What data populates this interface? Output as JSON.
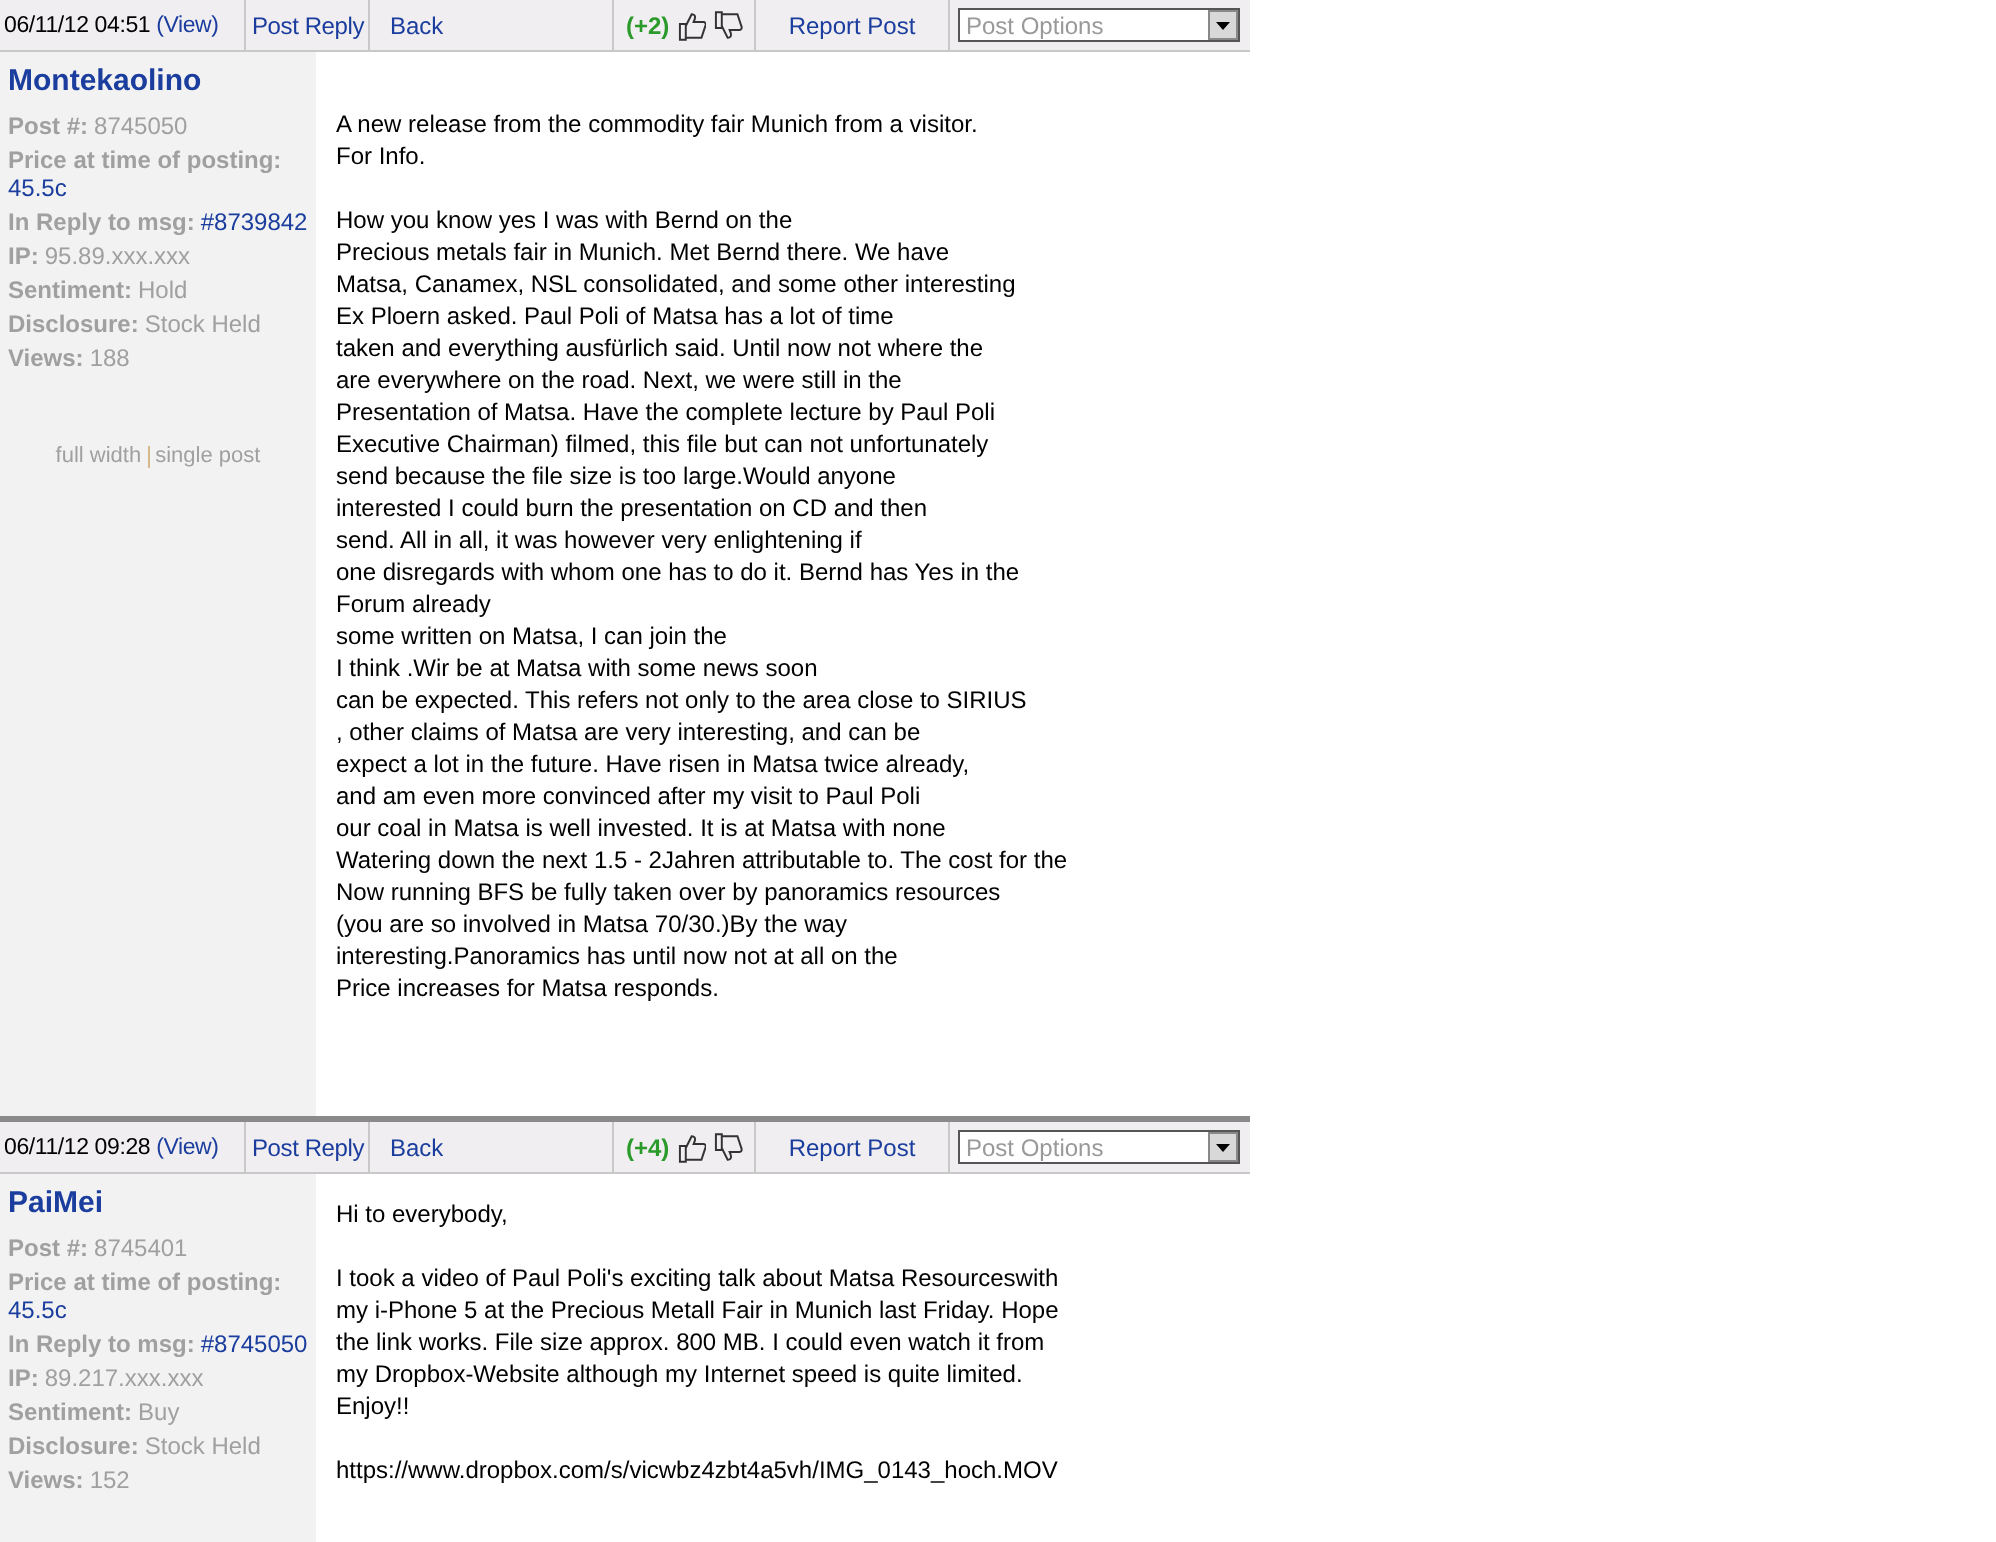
{
  "posts": [
    {
      "header": {
        "date": "06/11/12 04:51",
        "view": "(View)",
        "reply": "Post Reply",
        "back": "Back",
        "votes": "(+2)",
        "report": "Report Post",
        "options": {
          "placeholder": "Post Options"
        }
      },
      "author": "Montekaolino",
      "fields": [
        {
          "label": "Post #:",
          "value": "8745050",
          "link": false
        },
        {
          "label": "Price at time of posting:",
          "value": "45.5c",
          "link": true
        },
        {
          "label": "In Reply to msg:",
          "value": "#8739842",
          "link": true
        },
        {
          "label": "IP:",
          "value": "95.89.xxx.xxx",
          "link": false
        },
        {
          "label": "Sentiment:",
          "value": "Hold",
          "link": false
        },
        {
          "label": "Disclosure:",
          "value": "Stock Held",
          "link": false
        },
        {
          "label": "Views:",
          "value": "188",
          "link": false
        }
      ],
      "links": [
        "full width",
        "single post"
      ],
      "paragraphs": [
        "A new release from the commodity fair Munich from a visitor.\nFor Info.",
        "How you know yes I was with Bernd on the\nPrecious metals fair in Munich. Met Bernd there. We have\nMatsa, Canamex, NSL consolidated, and some other interesting\nEx Ploern asked. Paul Poli of Matsa has a lot of time\ntaken and everything ausfürlich said. Until now not where the\nare everywhere on the road. Next, we were still in the\nPresentation of Matsa. Have the complete lecture by Paul Poli\nExecutive Chairman) filmed, this file but can not unfortunately\nsend because the file size is too large.Would anyone\ninterested I could burn the presentation on CD and then\nsend. All in all, it was however very enlightening if\none disregards with whom one has to do it. Bernd has Yes in the\nForum already\nsome written on Matsa, I can join the\nI think .Wir be at Matsa with some news soon\ncan be expected. This refers not only to the area close to SIRIUS\n, other claims of Matsa are very interesting, and can be\nexpect a lot in the future. Have risen in Matsa twice already,\nand am even more convinced after my visit to Paul Poli\nour coal in Matsa is well invested. It is at Matsa with none\nWatering down the next 1.5 - 2Jahren attributable to. The cost for the\nNow running BFS be fully taken over by panoramics resources\n(you are so involved in Matsa 70/30.)By the way\ninteresting.Panoramics has until now not at all on the\nPrice increases for Matsa responds."
      ]
    },
    {
      "header": {
        "date": "06/11/12 09:28",
        "view": "(View)",
        "reply": "Post Reply",
        "back": "Back",
        "votes": "(+4)",
        "report": "Report Post",
        "options": {
          "placeholder": "Post Options"
        }
      },
      "author": "PaiMei",
      "fields": [
        {
          "label": "Post #:",
          "value": "8745401",
          "link": false
        },
        {
          "label": "Price at time of posting:",
          "value": "45.5c",
          "link": true
        },
        {
          "label": "In Reply to msg:",
          "value": "#8745050",
          "link": true
        },
        {
          "label": "IP:",
          "value": "89.217.xxx.xxx",
          "link": false
        },
        {
          "label": "Sentiment:",
          "value": "Buy",
          "link": false
        },
        {
          "label": "Disclosure:",
          "value": "Stock Held",
          "link": false
        },
        {
          "label": "Views:",
          "value": "152",
          "link": false
        }
      ],
      "paragraphs": [
        "Hi to everybody,",
        "I took a video of Paul Poli's exciting talk about Matsa Resourceswith\nmy i-Phone 5 at the Precious Metall Fair in Munich last Friday. Hope\nthe link works. File size approx. 800 MB. I could even watch it from\nmy Dropbox-Website although my Internet speed is quite limited.\nEnjoy!!",
        "https://www.dropbox.com/s/vicwbz4zbt4a5vh/IMG_0143_hoch.MOV"
      ]
    }
  ]
}
